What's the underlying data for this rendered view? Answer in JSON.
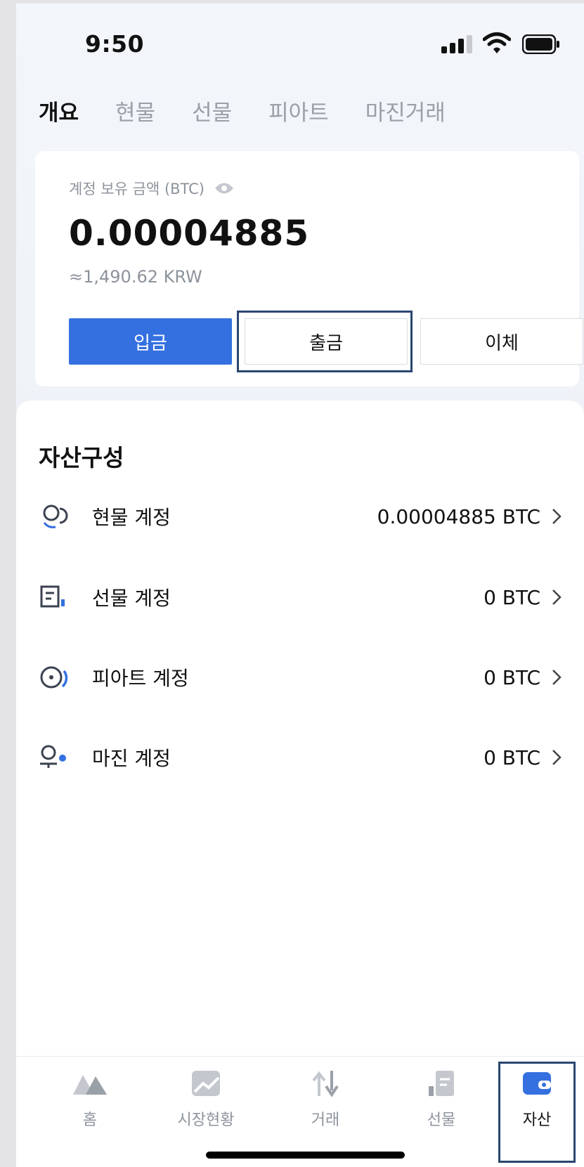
{
  "status": {
    "time": "9:50"
  },
  "tabs": [
    {
      "label": "개요",
      "active": true
    },
    {
      "label": "현물"
    },
    {
      "label": "선물"
    },
    {
      "label": "피아트"
    },
    {
      "label": "마진거래"
    }
  ],
  "balance": {
    "label": "계정 보유 금액 (BTC)",
    "amount": "0.00004885",
    "fiat": "≈1,490.62 KRW",
    "buttons": {
      "deposit": "입금",
      "withdraw": "출금",
      "transfer": "이체"
    }
  },
  "assets": {
    "title": "자산구성",
    "rows": [
      {
        "name": "현물 계정",
        "value": "0.00004885 BTC",
        "icon": "spot-account-icon"
      },
      {
        "name": "선물 계정",
        "value": "0 BTC",
        "icon": "futures-account-icon"
      },
      {
        "name": "피아트 계정",
        "value": "0 BTC",
        "icon": "fiat-account-icon"
      },
      {
        "name": "마진 계정",
        "value": "0 BTC",
        "icon": "margin-account-icon"
      }
    ]
  },
  "nav": [
    {
      "label": "홈",
      "icon": "home-icon"
    },
    {
      "label": "시장현황",
      "icon": "market-icon"
    },
    {
      "label": "거래",
      "icon": "trade-icon"
    },
    {
      "label": "선물",
      "icon": "futures-icon"
    },
    {
      "label": "자산",
      "icon": "wallet-icon",
      "active": true
    }
  ],
  "colors": {
    "primary": "#3470e0",
    "highlight": "#2b4670",
    "muted": "#8d939c"
  }
}
